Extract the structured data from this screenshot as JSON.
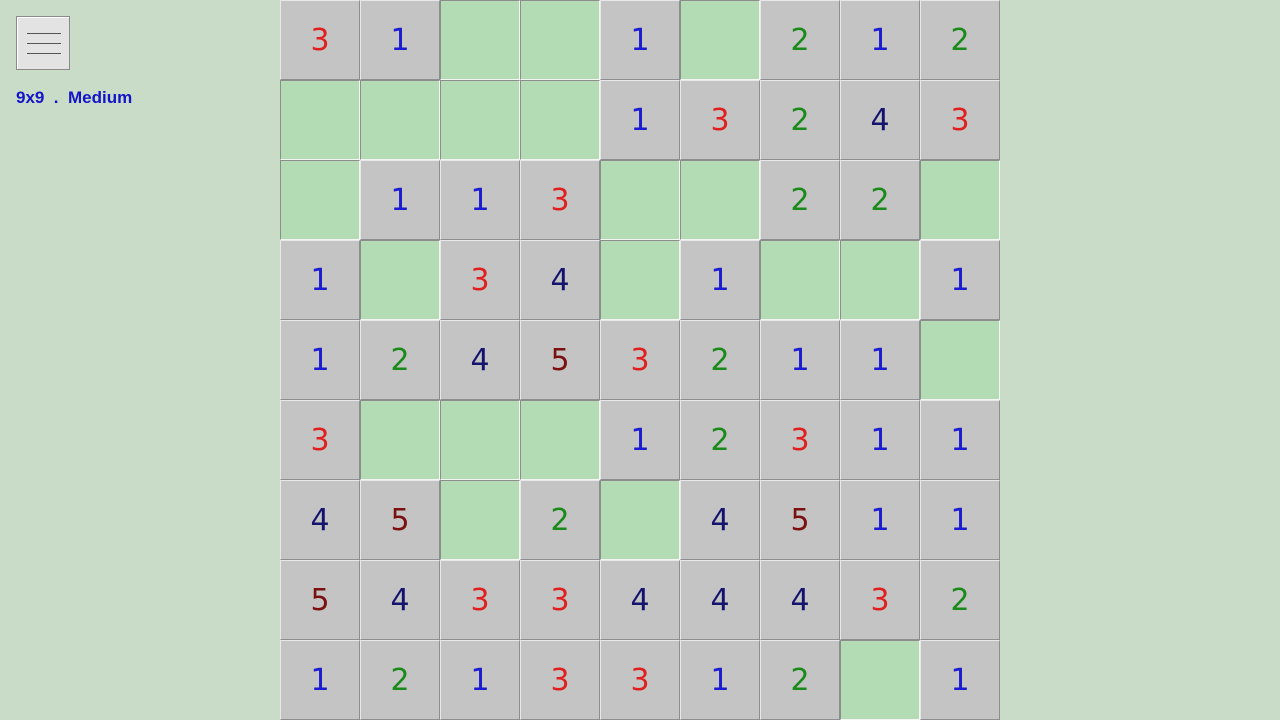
{
  "header": {
    "menu_icon": "hamburger-menu-icon",
    "game_info": "9x9  .  Medium"
  },
  "colors": {
    "1": "#1a1ad0",
    "2": "#1a8a1a",
    "3": "#e02020",
    "4": "#14146e",
    "5": "#7a1010",
    "blank_cell": "#b4dcb4",
    "number_cell": "#c4c4c4",
    "background": "#c8dcc8",
    "info_text": "#1414c8"
  },
  "board": {
    "size": 9,
    "rows": [
      [
        "3",
        "1",
        "",
        "",
        "1",
        "",
        "2",
        "1",
        "2"
      ],
      [
        "",
        "",
        "",
        "",
        "1",
        "3",
        "2",
        "4",
        "3"
      ],
      [
        "",
        "1",
        "1",
        "3",
        "",
        "",
        "2",
        "2",
        ""
      ],
      [
        "1",
        "",
        "3",
        "4",
        "",
        "1",
        "",
        "",
        "1"
      ],
      [
        "1",
        "2",
        "4",
        "5",
        "3",
        "2",
        "1",
        "1",
        ""
      ],
      [
        "3",
        "",
        "",
        "",
        "1",
        "2",
        "3",
        "1",
        "1"
      ],
      [
        "4",
        "5",
        "",
        "2",
        "",
        "4",
        "5",
        "1",
        "1"
      ],
      [
        "5",
        "4",
        "3",
        "3",
        "4",
        "4",
        "4",
        "3",
        "2"
      ],
      [
        "1",
        "2",
        "1",
        "3",
        "3",
        "1",
        "2",
        "",
        "1"
      ]
    ]
  }
}
